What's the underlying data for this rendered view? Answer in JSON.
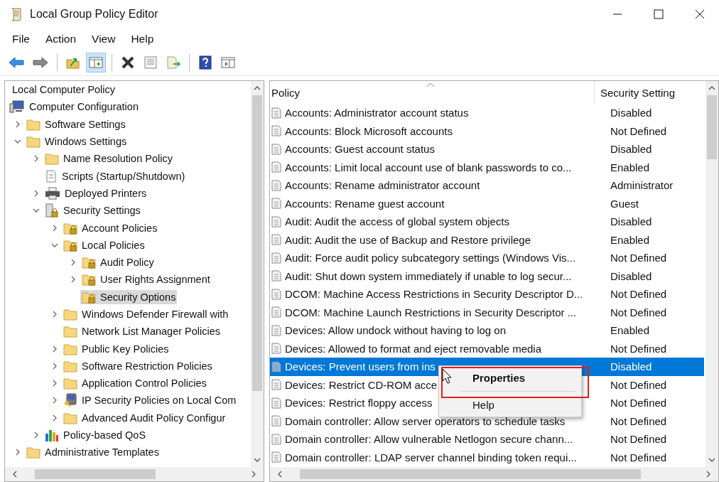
{
  "window": {
    "title": "Local Group Policy Editor"
  },
  "menu": [
    "File",
    "Action",
    "View",
    "Help"
  ],
  "toolbar": [
    [
      {
        "pressed": false
      },
      {
        "pressed": false
      }
    ],
    [
      {
        "pressed": false
      },
      {
        "pressed": true
      }
    ],
    [
      {
        "pressed": false
      },
      {
        "pressed": false
      },
      {
        "pressed": false
      }
    ],
    [
      {
        "pressed": false
      },
      {
        "pressed": false
      }
    ]
  ],
  "tree_root": "Local Computer Policy",
  "tree": [
    {
      "label": "Computer Configuration",
      "kind": "computer",
      "selected": false,
      "children": [
        {
          "label": "Software Settings",
          "kind": "folder",
          "expanded": false,
          "selected": false
        },
        {
          "label": "Windows Settings",
          "kind": "folder",
          "expanded": true,
          "selected": false,
          "children": [
            {
              "label": "Name Resolution Policy",
              "kind": "folder",
              "expanded": false,
              "selected": false
            },
            {
              "label": "Scripts (Startup/Shutdown)",
              "kind": "script",
              "selected": false
            },
            {
              "label": "Deployed Printers",
              "kind": "printer",
              "expanded": false,
              "selected": false
            },
            {
              "label": "Security Settings",
              "kind": "security",
              "expanded": true,
              "selected": false,
              "children": [
                {
                  "label": "Account Policies",
                  "kind": "lockfolder",
                  "expanded": false,
                  "selected": false
                },
                {
                  "label": "Local Policies",
                  "kind": "lockfolder",
                  "expanded": true,
                  "selected": false,
                  "children": [
                    {
                      "label": "Audit Policy",
                      "kind": "lockfolder",
                      "expanded": false,
                      "selected": false
                    },
                    {
                      "label": "User Rights Assignment",
                      "kind": "lockfolder",
                      "expanded": false,
                      "selected": false
                    },
                    {
                      "label": "Security Options",
                      "kind": "lockfolder",
                      "selected": true
                    }
                  ]
                },
                {
                  "label": "Windows Defender Firewall with",
                  "kind": "folder",
                  "expanded": false,
                  "selected": false
                },
                {
                  "label": "Network List Manager Policies",
                  "kind": "folder",
                  "selected": false
                },
                {
                  "label": "Public Key Policies",
                  "kind": "folder",
                  "expanded": false,
                  "selected": false
                },
                {
                  "label": "Software Restriction Policies",
                  "kind": "folder",
                  "expanded": false,
                  "selected": false
                },
                {
                  "label": "Application Control Policies",
                  "kind": "folder",
                  "expanded": false,
                  "selected": false
                },
                {
                  "label": "IP Security Policies on Local Com",
                  "kind": "ip",
                  "expanded": false,
                  "selected": false
                },
                {
                  "label": "Advanced Audit Policy Configur",
                  "kind": "folder",
                  "expanded": false,
                  "selected": false
                }
              ]
            },
            {
              "label": "Policy-based QoS",
              "kind": "chart",
              "expanded": false,
              "selected": false
            }
          ]
        },
        {
          "label": "Administrative Templates",
          "kind": "folder",
          "expanded": false,
          "selected": false
        }
      ]
    }
  ],
  "table": {
    "columns": [
      "Policy",
      "Security Setting"
    ],
    "rows": [
      {
        "policy": "Accounts: Administrator account status",
        "setting": "Disabled",
        "selected": false
      },
      {
        "policy": "Accounts: Block Microsoft accounts",
        "setting": "Not Defined",
        "selected": false
      },
      {
        "policy": "Accounts: Guest account status",
        "setting": "Disabled",
        "selected": false
      },
      {
        "policy": "Accounts: Limit local account use of blank passwords to co...",
        "setting": "Enabled",
        "selected": false
      },
      {
        "policy": "Accounts: Rename administrator account",
        "setting": "Administrator",
        "selected": false
      },
      {
        "policy": "Accounts: Rename guest account",
        "setting": "Guest",
        "selected": false
      },
      {
        "policy": "Audit: Audit the access of global system objects",
        "setting": "Disabled",
        "selected": false
      },
      {
        "policy": "Audit: Audit the use of Backup and Restore privilege",
        "setting": "Enabled",
        "selected": false
      },
      {
        "policy": "Audit: Force audit policy subcategory settings (Windows Vis...",
        "setting": "Not Defined",
        "selected": false
      },
      {
        "policy": "Audit: Shut down system immediately if unable to log secur...",
        "setting": "Disabled",
        "selected": false
      },
      {
        "policy": "DCOM: Machine Access Restrictions in Security Descriptor D...",
        "setting": "Not Defined",
        "selected": false
      },
      {
        "policy": "DCOM: Machine Launch Restrictions in Security Descriptor ...",
        "setting": "Not Defined",
        "selected": false
      },
      {
        "policy": "Devices: Allow undock without having to log on",
        "setting": "Enabled",
        "selected": false
      },
      {
        "policy": "Devices: Allowed to format and eject removable media",
        "setting": "Not Defined",
        "selected": false
      },
      {
        "policy": "Devices: Prevent users from ins",
        "setting": "Disabled",
        "selected": true
      },
      {
        "policy": "Devices: Restrict CD-ROM acce",
        "setting": "Not Defined",
        "selected": false
      },
      {
        "policy": "Devices: Restrict floppy access",
        "setting": "Not Defined",
        "selected": false
      },
      {
        "policy": "Domain controller: Allow server operators to schedule tasks",
        "setting": "Not Defined",
        "selected": false
      },
      {
        "policy": "Domain controller: Allow vulnerable Netlogon secure chann...",
        "setting": "Not Defined",
        "selected": false
      },
      {
        "policy": "Domain controller: LDAP server channel binding token requi...",
        "setting": "Not Defined",
        "selected": false
      }
    ]
  },
  "context_menu": {
    "items": [
      {
        "label": "Properties",
        "kind": "default"
      },
      {
        "label": "Help",
        "kind": "normal"
      }
    ]
  }
}
